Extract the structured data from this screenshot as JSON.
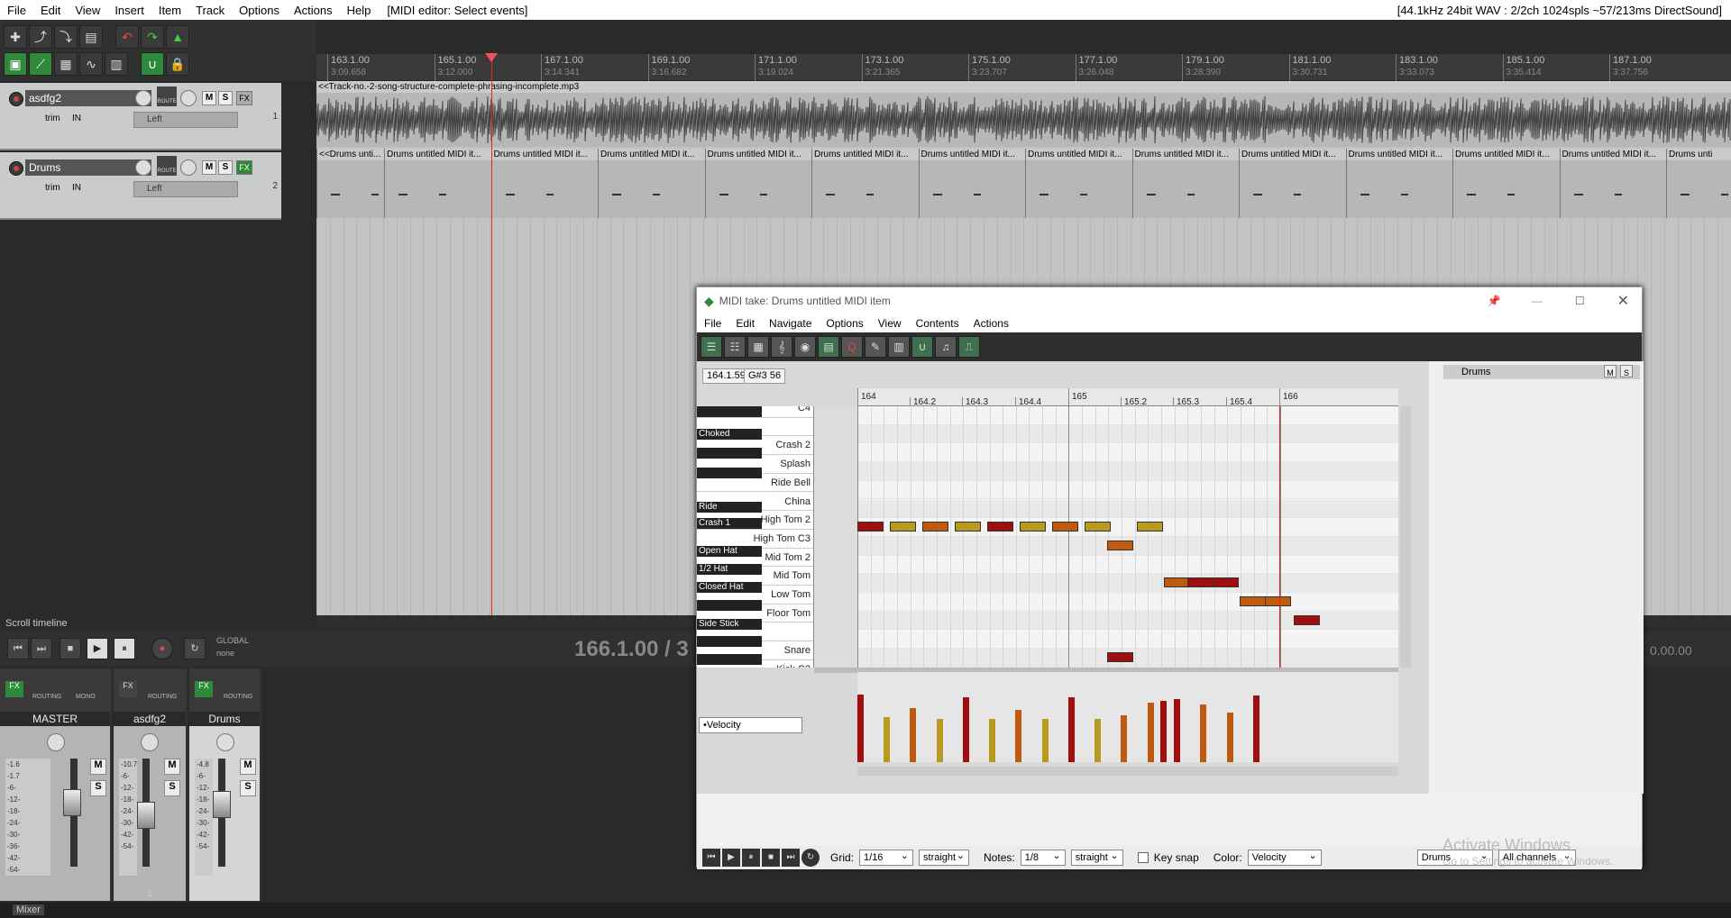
{
  "menubar": {
    "items": [
      "File",
      "Edit",
      "View",
      "Insert",
      "Item",
      "Track",
      "Options",
      "Actions",
      "Help"
    ],
    "title": "[MIDI editor: Select events]",
    "status": "[44.1kHz 24bit WAV : 2/2ch 1024spls ~57/213ms DirectSound]"
  },
  "tracks": [
    {
      "name": "asdfg2",
      "trim": "trim",
      "in": "IN",
      "pan": "Left",
      "num": "1",
      "route": "ROUTE",
      "m": "M",
      "s": "S",
      "fx": "FX"
    },
    {
      "name": "Drums",
      "trim": "trim",
      "in": "IN",
      "pan": "Left",
      "num": "2",
      "route": "ROUTE",
      "m": "M",
      "s": "S",
      "fx": "FX"
    }
  ],
  "ruler": [
    {
      "bar": "163.1.00",
      "time": "3:09.658"
    },
    {
      "bar": "165.1.00",
      "time": "3:12.000"
    },
    {
      "bar": "167.1.00",
      "time": "3:14.341"
    },
    {
      "bar": "169.1.00",
      "time": "3:16.682"
    },
    {
      "bar": "171.1.00",
      "time": "3:19.024"
    },
    {
      "bar": "173.1.00",
      "time": "3:21.365"
    },
    {
      "bar": "175.1.00",
      "time": "3:23.707"
    },
    {
      "bar": "177.1.00",
      "time": "3:26.048"
    },
    {
      "bar": "179.1.00",
      "time": "3:28.390"
    },
    {
      "bar": "181.1.00",
      "time": "3:30.731"
    },
    {
      "bar": "183.1.00",
      "time": "3:33.073"
    },
    {
      "bar": "185.1.00",
      "time": "3:35.414"
    },
    {
      "bar": "187.1.00",
      "time": "3:37.756"
    }
  ],
  "audio_item": "<<Track-no.-2-song-structure-complete-phrasing-incomplete.mp3",
  "midi_items": [
    "<<Drums unti...",
    "Drums untitled MIDI it...",
    "Drums untitled MIDI it...",
    "Drums untitled MIDI it...",
    "Drums untitled MIDI it...",
    "Drums untitled MIDI it...",
    "Drums untitled MIDI it...",
    "Drums untitled MIDI it...",
    "Drums untitled MIDI it...",
    "Drums untitled MIDI it...",
    "Drums untitled MIDI it...",
    "Drums untitled MIDI it...",
    "Drums untitled MIDI it...",
    "Drums unti"
  ],
  "scroll_label": "Scroll timeline",
  "transport": {
    "position": "166.1.00 / 3",
    "global": "GLOBAL",
    "none": "none",
    "right_time": "0.00.00"
  },
  "mixer": [
    {
      "name": "MASTER",
      "num": "",
      "fx": "FX",
      "routing": "ROUTING",
      "mono": "MONO",
      "ticks": [
        "-1.6",
        "-1.7",
        "-6-",
        "-12-",
        "-18-",
        "-24-",
        "-30-",
        "-36-",
        "-42-",
        "-54-"
      ]
    },
    {
      "name": "asdfg2",
      "num": "1",
      "fx": "FX",
      "routing": "ROUTING",
      "mono": "",
      "ticks": [
        "-10.7",
        "-6-",
        "-12-",
        "-18-",
        "-24-",
        "-30-",
        "-42-",
        "-54-"
      ]
    },
    {
      "name": "Drums",
      "num": "2",
      "fx": "FX",
      "routing": "ROUTING",
      "mono": "",
      "ticks": [
        "-4.8",
        "-6-",
        "-12-",
        "-18-",
        "-24-",
        "-30-",
        "-42-",
        "-54-"
      ]
    }
  ],
  "mixer_tab": "Mixer",
  "midi_editor": {
    "title": "MIDI take: Drums untitled MIDI item",
    "menu": [
      "File",
      "Edit",
      "Navigate",
      "Options",
      "View",
      "Contents",
      "Actions"
    ],
    "pos_box": "164.1.59",
    "note_box": "G#3  56",
    "ruler": [
      "164",
      "164.2",
      "164.3",
      "164.4",
      "165",
      "165.2",
      "165.3",
      "165.4",
      "166"
    ],
    "keys_white": [
      "C4",
      "",
      "Crash 2",
      "Splash",
      "Ride Bell",
      "China",
      "High Tom 2",
      "High Tom  C3",
      "Mid Tom 2",
      "Mid Tom",
      "Low Tom",
      "Floor Tom",
      "",
      "Snare",
      "Kick  C2",
      "",
      ""
    ],
    "keys_black": [
      "Choked",
      "Ride",
      "Crash 1",
      "Open Hat",
      "1/2 Hat",
      "Closed Hat",
      "Side Stick"
    ],
    "track_panel": "Drums",
    "cc_lane": "•Velocity",
    "grid_label": "Grid:",
    "grid_value": "1/16",
    "grid_type": "straight",
    "notes_label": "Notes:",
    "notes_value": "1/8",
    "notes_type": "straight",
    "key_snap": "Key snap",
    "color_label": "Color:",
    "color_value": "Velocity",
    "channel_track": "Drums",
    "channels": "All channels",
    "m": "M",
    "s": "S"
  },
  "watermark": "Activate Windows",
  "watermark_sub": "Go to Settings to activate Windows.",
  "colors": {
    "note_red": "#a00f0f",
    "note_orange": "#c05a10",
    "note_yellow": "#b89a20",
    "accent_green": "#2e8a3a",
    "playhead": "#e22222"
  }
}
